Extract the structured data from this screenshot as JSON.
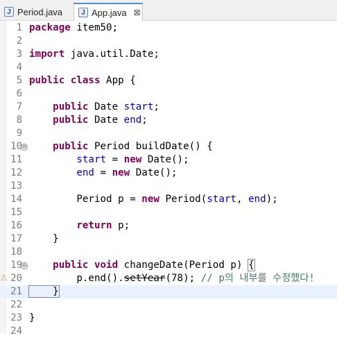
{
  "tabs": [
    {
      "label": "Period.java",
      "icon": "java-file-icon",
      "active": false
    },
    {
      "label": "App.java",
      "icon": "java-file-icon",
      "active": true,
      "close_label": "⊠"
    }
  ],
  "editor": {
    "fold_glyph": "⊖",
    "lines": [
      {
        "num": "1"
      },
      {
        "num": "2"
      },
      {
        "num": "3"
      },
      {
        "num": "4"
      },
      {
        "num": "5"
      },
      {
        "num": "6"
      },
      {
        "num": "7"
      },
      {
        "num": "8"
      },
      {
        "num": "9"
      },
      {
        "num": "10"
      },
      {
        "num": "11"
      },
      {
        "num": "12"
      },
      {
        "num": "13"
      },
      {
        "num": "14"
      },
      {
        "num": "15"
      },
      {
        "num": "16"
      },
      {
        "num": "17"
      },
      {
        "num": "18"
      },
      {
        "num": "19"
      },
      {
        "num": "20"
      },
      {
        "num": "21"
      },
      {
        "num": "22"
      },
      {
        "num": "23"
      },
      {
        "num": "24"
      }
    ],
    "code": {
      "l1": [
        "package",
        " item50;"
      ],
      "l3": [
        "import",
        " java.util.Date;"
      ],
      "l5": [
        "public",
        " ",
        "class",
        " App {"
      ],
      "l7": [
        "    ",
        "public",
        " Date ",
        "start",
        ";"
      ],
      "l8": [
        "    ",
        "public",
        " Date ",
        "end",
        ";"
      ],
      "l10": [
        "    ",
        "public",
        " Period buildDate() {"
      ],
      "l11": [
        "        ",
        "start",
        " = ",
        "new",
        " Date();"
      ],
      "l12": [
        "        ",
        "end",
        " = ",
        "new",
        " Date();"
      ],
      "l14": [
        "        Period p = ",
        "new",
        " Period(",
        "start",
        ", ",
        "end",
        ");"
      ],
      "l16": [
        "        ",
        "return",
        " p;"
      ],
      "l17": [
        "    }"
      ],
      "l19": [
        "    ",
        "public",
        " ",
        "void",
        " changeDate(Period p) ",
        "{"
      ],
      "l20": [
        "        p.end().",
        "setYear",
        "(78); ",
        "// p의 내부를 수정했다!"
      ],
      "l21": [
        "    }"
      ],
      "l23": [
        "}"
      ]
    },
    "colors": {
      "keyword": "#7f0055",
      "field": "#0000c0",
      "comment": "#3f7f5f",
      "current_line": "#e8f2fe"
    }
  }
}
